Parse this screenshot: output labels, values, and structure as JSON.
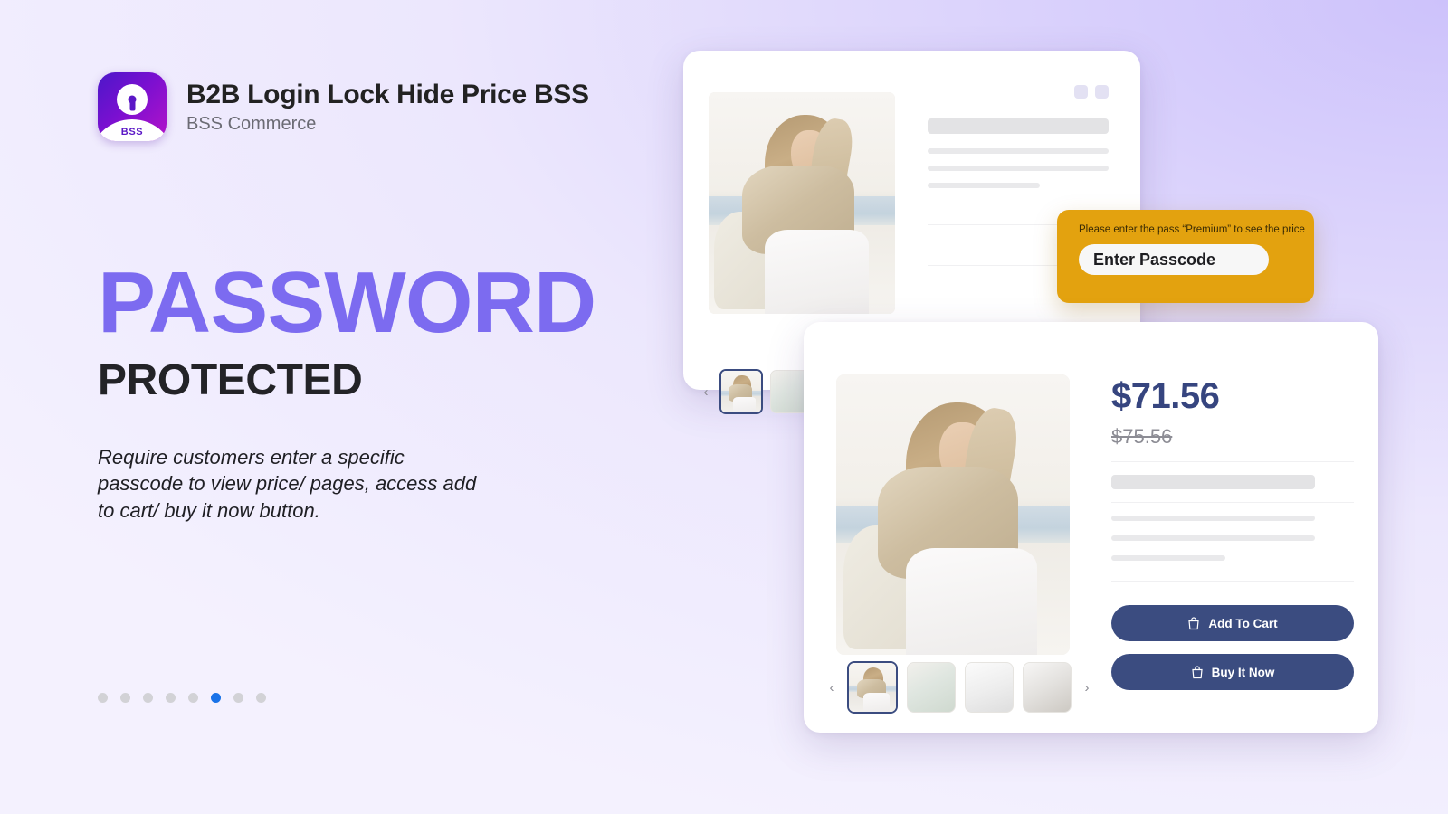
{
  "brand": {
    "app_title": "B2B Login Lock Hide Price BSS",
    "vendor": "BSS Commerce",
    "logo_text": "BSS",
    "logo_icon": "keyhole-lock-icon"
  },
  "hero": {
    "headline_primary": "PASSWORD",
    "headline_secondary": "PROTECTED",
    "description": "Require customers enter a specific passcode to view price/ pages, access add to cart/ buy it now button.",
    "accent_color": "#7c6bf0",
    "secondary_color": "#232327"
  },
  "carousel": {
    "total_dots": 8,
    "active_index": 6,
    "active_color": "#1a73e8",
    "inactive_color": "#d2d2d6"
  },
  "passcode_card": {
    "label": "Please enter the pass “Premium” to see the price",
    "input_text": "Enter Passcode",
    "background_color": "#e3a20f"
  },
  "back_card": {
    "thumbnail_prev": "‹",
    "thumbnail_next": "›",
    "chip_count": 2
  },
  "front_card": {
    "price_current": "$71.56",
    "price_old": "$75.56",
    "price_color": "#36457f",
    "add_to_cart_label": "Add To Cart",
    "buy_now_label": "Buy It Now",
    "button_color": "#3b4c80",
    "thumbnail_prev": "‹",
    "thumbnail_next": "›",
    "cart_icon": "shopping-bag-icon"
  },
  "cursor": {
    "icon": "mouse-pointer-icon",
    "color": "#7c5cf5"
  }
}
